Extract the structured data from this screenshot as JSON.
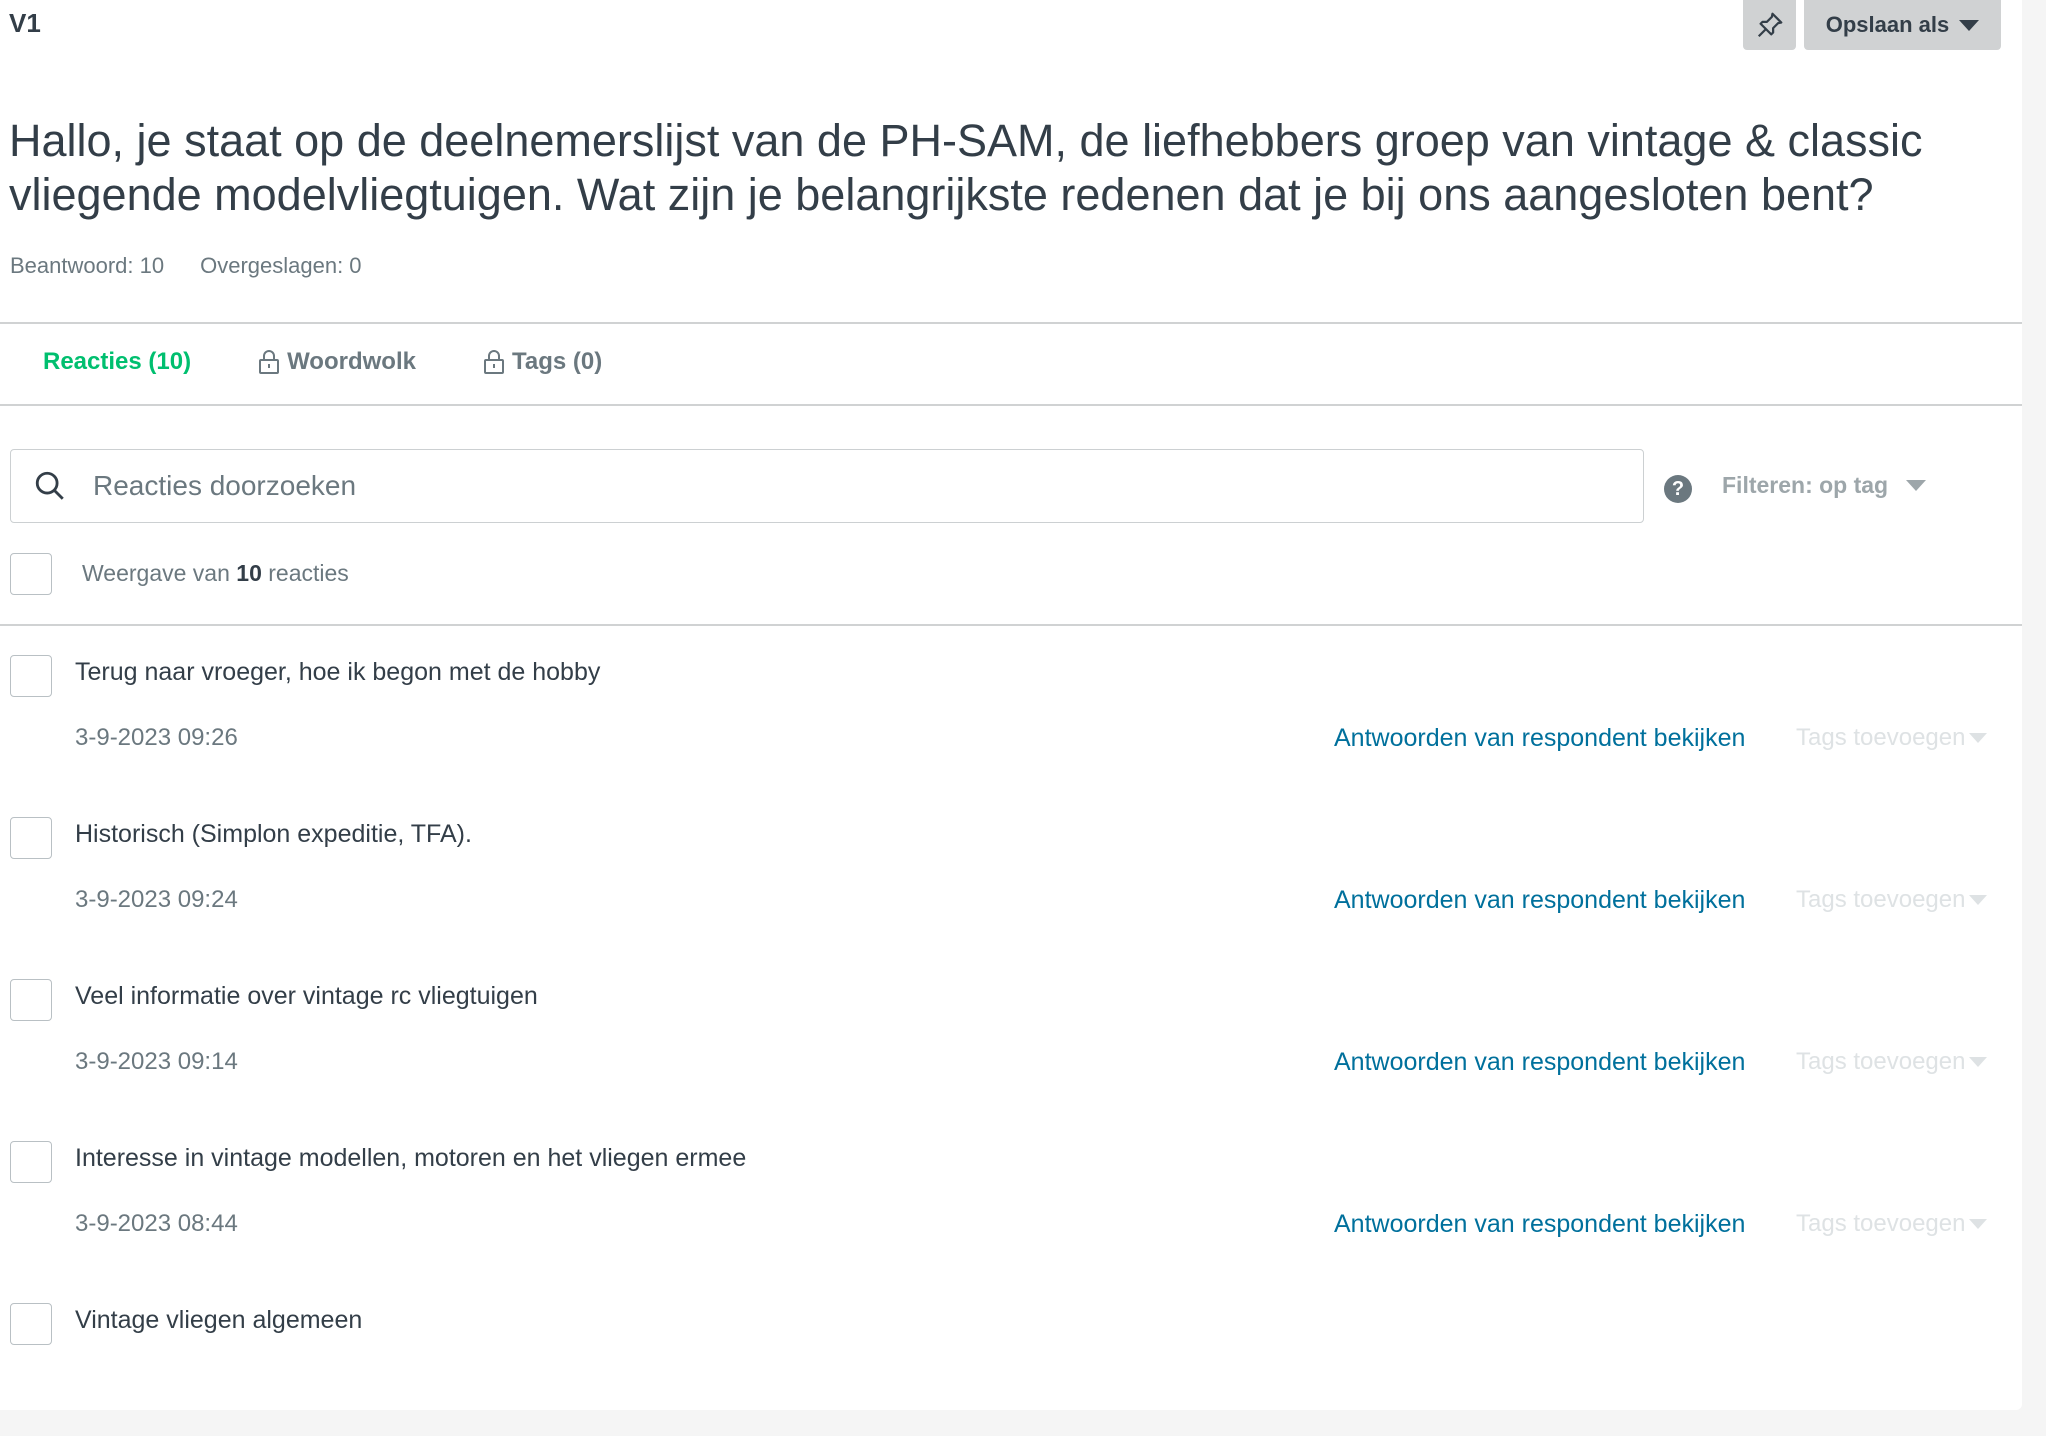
{
  "question": {
    "number": "V1",
    "text": "Hallo, je staat op de deelnemerslijst van de PH-SAM, de liefhebbers groep van vintage & classic vliegende modelvliegtuigen. Wat zijn je belangrijkste redenen dat je bij ons aangesloten bent?",
    "answered": "Beantwoord: 10",
    "skipped": "Overgeslagen: 0"
  },
  "toolbar": {
    "pin_icon": "pin-icon",
    "save_label": "Opslaan als"
  },
  "tabs": [
    {
      "label": "Reacties (10)",
      "active": true,
      "locked": false
    },
    {
      "label": "Woordwolk",
      "active": false,
      "locked": true
    },
    {
      "label": "Tags (0)",
      "active": false,
      "locked": true
    }
  ],
  "search": {
    "placeholder": "Reacties doorzoeken",
    "value": ""
  },
  "filter": {
    "help": "?",
    "label": "Filteren: op tag"
  },
  "summary": {
    "prefix": "Weergave van",
    "count": "10",
    "suffix": "reacties"
  },
  "responses": [
    {
      "text": "Terug naar vroeger, hoe ik begon met de hobby",
      "date": "3-9-2023 09:26",
      "link": "Antwoorden van respondent bekijken",
      "tags": "Tags toevoegen"
    },
    {
      "text": "Historisch (Simplon expeditie, TFA).",
      "date": "3-9-2023 09:24",
      "link": "Antwoorden van respondent bekijken",
      "tags": "Tags toevoegen"
    },
    {
      "text": "Veel informatie over vintage rc vliegtuigen",
      "date": "3-9-2023 09:14",
      "link": "Antwoorden van respondent bekijken",
      "tags": "Tags toevoegen"
    },
    {
      "text": "Interesse in vintage modellen, motoren en het vliegen ermee",
      "date": "3-9-2023 08:44",
      "link": "Antwoorden van respondent bekijken",
      "tags": "Tags toevoegen"
    },
    {
      "text": "Vintage vliegen algemeen"
    }
  ],
  "colors": {
    "accent": "#00bf6f",
    "link": "#00709c",
    "text": "#333e48",
    "muted": "#6b787f",
    "button_bg": "#d0d2d3"
  }
}
